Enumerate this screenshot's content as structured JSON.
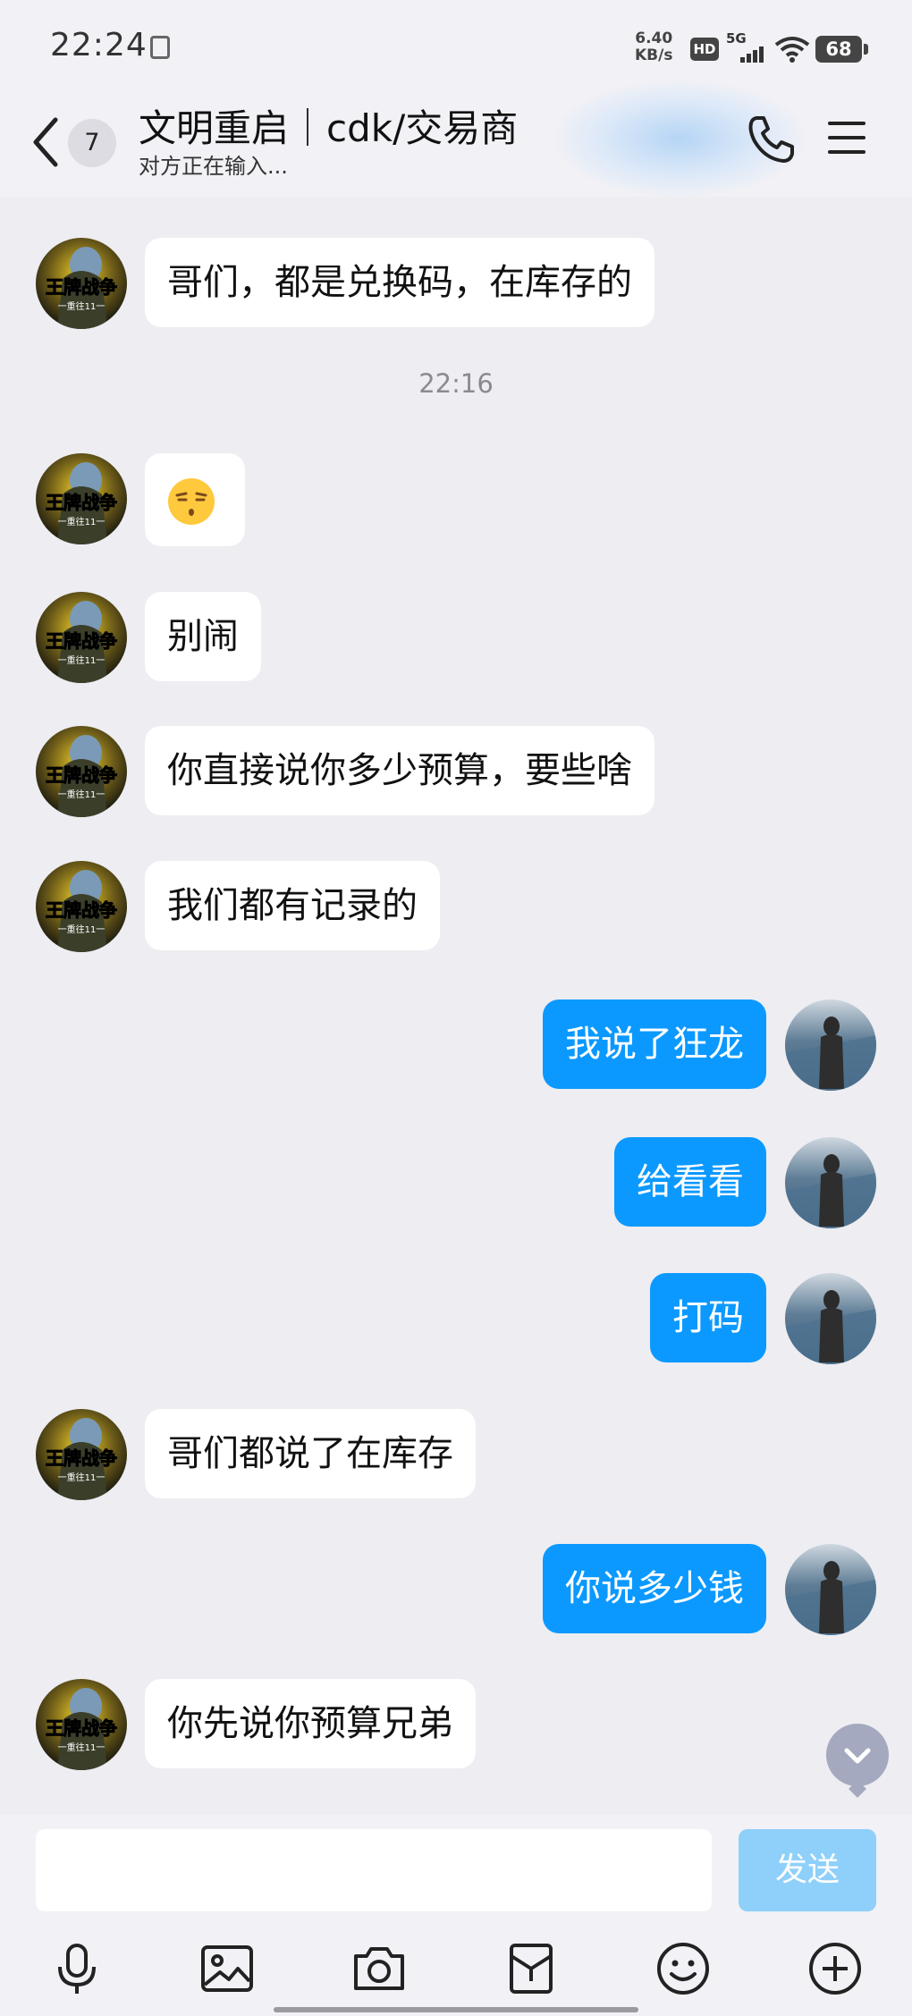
{
  "status_bar": {
    "time": "22:24",
    "net_speed_value": "6.40",
    "net_speed_unit": "KB/s",
    "hd_label": "HD",
    "network_label": "5G",
    "battery": "68"
  },
  "header": {
    "unread_count": "7",
    "title": "文明重启｜cdk/交易商",
    "status": "对方正在输入..."
  },
  "timestamp": "22:16",
  "messages": [
    {
      "side": "in",
      "text": "哥们，都是兑换码，在库存的"
    },
    {
      "side": "in",
      "text": "",
      "emoji": "smirk-face"
    },
    {
      "side": "in",
      "text": "别闹"
    },
    {
      "side": "in",
      "text": "你直接说你多少预算，要些啥"
    },
    {
      "side": "in",
      "text": "我们都有记录的"
    },
    {
      "side": "out",
      "text": "我说了狂龙"
    },
    {
      "side": "out",
      "text": "给看看"
    },
    {
      "side": "out",
      "text": "打码"
    },
    {
      "side": "in",
      "text": "哥们都说了在库存"
    },
    {
      "side": "out",
      "text": "你说多少钱"
    },
    {
      "side": "in",
      "text": "你先说你预算兄弟"
    }
  ],
  "avatar_text": {
    "line1": "王牌战争",
    "line2": "一重往11一"
  },
  "composer": {
    "input_value": "",
    "send_label": "发送"
  },
  "toolbar": [
    "microphone-icon",
    "image-icon",
    "camera-icon",
    "red-packet-icon",
    "emoji-icon",
    "plus-icon"
  ],
  "colors": {
    "background": "#ededf2",
    "bubble_out": "#0b99ff",
    "bubble_in": "#ffffff",
    "send_disabled": "#8fd0fb"
  }
}
